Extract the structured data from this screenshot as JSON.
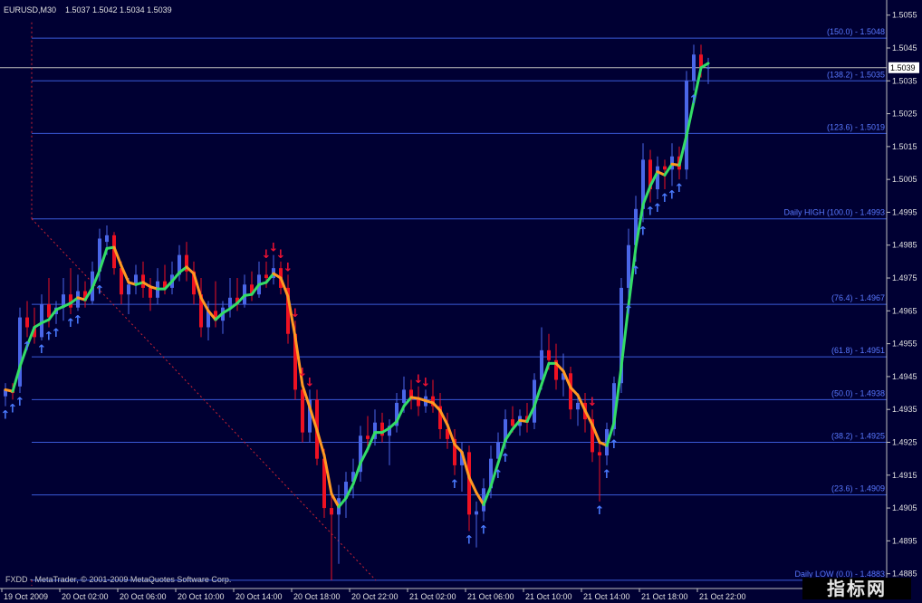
{
  "header": {
    "symbol_timeframe": "EURUSD,M30",
    "ohlc": "1.5037 1.5042 1.5034 1.5039"
  },
  "footer": {
    "copyright": "FXDD - MetaTrader, © 2001-2009 MetaQuotes Software Corp."
  },
  "watermark": "指标网",
  "colors": {
    "background": "#000033",
    "fib_line": "#3a5ad8",
    "fib_label": "#5878ff",
    "bull": "#4a66e8",
    "bear": "#ee1122",
    "ma_up": "#33dd66",
    "ma_down": "#ff9922",
    "arrow_up": "#4a7aff",
    "arrow_down": "#ee1133",
    "axis": "#c0c0c0",
    "price_line": "#c0c0c0"
  },
  "chart_data": {
    "type": "candlestick",
    "symbol": "EURUSD",
    "timeframe": "M30",
    "ylim": [
      1.48805,
      1.50585
    ],
    "price_ticks": [
      "1.5055",
      "1.5045",
      "1.5035",
      "1.5025",
      "1.5015",
      "1.5005",
      "1.4995",
      "1.4985",
      "1.4975",
      "1.4965",
      "1.4955",
      "1.4945",
      "1.4935",
      "1.4925",
      "1.4915",
      "1.4905",
      "1.4895",
      "1.4885"
    ],
    "time_labels": [
      {
        "label": "19 Oct 2009",
        "bar": 0
      },
      {
        "label": "20 Oct 02:00",
        "bar": 8
      },
      {
        "label": "20 Oct 06:00",
        "bar": 16
      },
      {
        "label": "20 Oct 10:00",
        "bar": 24
      },
      {
        "label": "20 Oct 14:00",
        "bar": 32
      },
      {
        "label": "20 Oct 18:00",
        "bar": 40
      },
      {
        "label": "20 Oct 22:00",
        "bar": 48
      },
      {
        "label": "21 Oct 02:00",
        "bar": 56
      },
      {
        "label": "21 Oct 06:00",
        "bar": 64
      },
      {
        "label": "21 Oct 10:00",
        "bar": 72
      },
      {
        "label": "21 Oct 14:00",
        "bar": 80
      },
      {
        "label": "21 Oct 18:00",
        "bar": 88
      },
      {
        "label": "21 Oct 22:00",
        "bar": 96
      }
    ],
    "current_price": "1.5039",
    "fib_levels": [
      {
        "label": "(150.0) - 1.5048",
        "price": 1.5048
      },
      {
        "label": "(138.2) - 1.5035",
        "price": 1.5035
      },
      {
        "label": "(123.6) - 1.5019",
        "price": 1.5019
      },
      {
        "label": "Daily HIGH (100.0) - 1.4993",
        "price": 1.4993
      },
      {
        "label": "(76.4) - 1.4967",
        "price": 1.4967
      },
      {
        "label": "(61.8) - 1.4951",
        "price": 1.4951
      },
      {
        "label": "(50.0) - 1.4938",
        "price": 1.4938
      },
      {
        "label": "(38.2) - 1.4925",
        "price": 1.4925
      },
      {
        "label": "(23.6) - 1.4909",
        "price": 1.4909
      },
      {
        "label": "Daily LOW (0.0) - 1.4883",
        "price": 1.4883
      }
    ],
    "candles": [
      [
        1.4939,
        1.4943,
        1.4936,
        1.4941
      ],
      [
        1.4941,
        1.4943,
        1.4938,
        1.494
      ],
      [
        1.4942,
        1.4966,
        1.494,
        1.4963
      ],
      [
        1.4963,
        1.4968,
        1.4957,
        1.496
      ],
      [
        1.496,
        1.4966,
        1.4955,
        1.4957
      ],
      [
        1.4957,
        1.497,
        1.4956,
        1.4967
      ],
      [
        1.4967,
        1.4975,
        1.496,
        1.4963
      ],
      [
        1.4964,
        1.4968,
        1.4961,
        1.4966
      ],
      [
        1.4966,
        1.4975,
        1.4962,
        1.497
      ],
      [
        1.497,
        1.4978,
        1.4964,
        1.4966
      ],
      [
        1.4966,
        1.4976,
        1.4965,
        1.4971
      ],
      [
        1.4971,
        1.4974,
        1.4966,
        1.4968
      ],
      [
        1.4968,
        1.498,
        1.4967,
        1.4977
      ],
      [
        1.4977,
        1.499,
        1.4974,
        1.4987
      ],
      [
        1.4986,
        1.4991,
        1.4982,
        1.4988
      ],
      [
        1.4988,
        1.4989,
        1.4976,
        1.4978
      ],
      [
        1.4978,
        1.498,
        1.4967,
        1.497
      ],
      [
        1.497,
        1.4975,
        1.4964,
        1.4973
      ],
      [
        1.4973,
        1.4979,
        1.497,
        1.4976
      ],
      [
        1.4976,
        1.498,
        1.4969,
        1.4972
      ],
      [
        1.4972,
        1.4975,
        1.4965,
        1.4969
      ],
      [
        1.4969,
        1.4978,
        1.4967,
        1.4974
      ],
      [
        1.4974,
        1.4979,
        1.497,
        1.4972
      ],
      [
        1.4972,
        1.498,
        1.497,
        1.4976
      ],
      [
        1.4976,
        1.4985,
        1.4974,
        1.4982
      ],
      [
        1.4982,
        1.4986,
        1.4974,
        1.4977
      ],
      [
        1.4977,
        1.498,
        1.4967,
        1.497
      ],
      [
        1.497,
        1.4975,
        1.4957,
        1.496
      ],
      [
        1.496,
        1.4968,
        1.4956,
        1.4965
      ],
      [
        1.4965,
        1.4974,
        1.496,
        1.4962
      ],
      [
        1.4962,
        1.4968,
        1.4958,
        1.4966
      ],
      [
        1.4966,
        1.4975,
        1.4963,
        1.4969
      ],
      [
        1.4969,
        1.4975,
        1.4965,
        1.4967
      ],
      [
        1.4967,
        1.4976,
        1.4966,
        1.4973
      ],
      [
        1.4973,
        1.4977,
        1.4968,
        1.497
      ],
      [
        1.497,
        1.498,
        1.4969,
        1.4976
      ],
      [
        1.4976,
        1.498,
        1.4972,
        1.4975
      ],
      [
        1.4975,
        1.4982,
        1.4973,
        1.4978
      ],
      [
        1.4978,
        1.498,
        1.497,
        1.4972
      ],
      [
        1.4972,
        1.4976,
        1.4955,
        1.4958
      ],
      [
        1.4958,
        1.4962,
        1.4938,
        1.4941
      ],
      [
        1.4941,
        1.4944,
        1.4925,
        1.4928
      ],
      [
        1.4928,
        1.4941,
        1.4925,
        1.4938
      ],
      [
        1.4938,
        1.4941,
        1.4918,
        1.492
      ],
      [
        1.492,
        1.4923,
        1.4902,
        1.4905
      ],
      [
        1.4905,
        1.4909,
        1.4883,
        1.4903
      ],
      [
        1.4903,
        1.4912,
        1.4888,
        1.4908
      ],
      [
        1.4908,
        1.4916,
        1.4902,
        1.4913
      ],
      [
        1.4913,
        1.492,
        1.4908,
        1.4916
      ],
      [
        1.4916,
        1.493,
        1.4913,
        1.4927
      ],
      [
        1.4927,
        1.4933,
        1.4922,
        1.4926
      ],
      [
        1.4926,
        1.4935,
        1.4924,
        1.4931
      ],
      [
        1.4931,
        1.4934,
        1.4925,
        1.4927
      ],
      [
        1.4927,
        1.4932,
        1.4918,
        1.493
      ],
      [
        1.493,
        1.494,
        1.4928,
        1.4937
      ],
      [
        1.4937,
        1.4945,
        1.4934,
        1.4941
      ],
      [
        1.4941,
        1.4944,
        1.4935,
        1.4938
      ],
      [
        1.4938,
        1.4942,
        1.4933,
        1.4936
      ],
      [
        1.4936,
        1.4941,
        1.4934,
        1.4939
      ],
      [
        1.4939,
        1.4944,
        1.4934,
        1.4936
      ],
      [
        1.4936,
        1.494,
        1.4926,
        1.4929
      ],
      [
        1.4929,
        1.4934,
        1.4923,
        1.4926
      ],
      [
        1.4926,
        1.4929,
        1.4915,
        1.4918
      ],
      [
        1.4918,
        1.4925,
        1.491,
        1.4922
      ],
      [
        1.4922,
        1.4924,
        1.4898,
        1.4903
      ],
      [
        1.4903,
        1.4907,
        1.4893,
        1.4904
      ],
      [
        1.4904,
        1.4914,
        1.4901,
        1.4911
      ],
      [
        1.4911,
        1.4924,
        1.4908,
        1.492
      ],
      [
        1.492,
        1.4928,
        1.4918,
        1.4925
      ],
      [
        1.4925,
        1.4935,
        1.4923,
        1.4932
      ],
      [
        1.4932,
        1.4936,
        1.4928,
        1.493
      ],
      [
        1.493,
        1.4935,
        1.4927,
        1.4933
      ],
      [
        1.4933,
        1.4937,
        1.4928,
        1.4931
      ],
      [
        1.4931,
        1.4946,
        1.4929,
        1.4944
      ],
      [
        1.4944,
        1.496,
        1.4941,
        1.4953
      ],
      [
        1.4953,
        1.4958,
        1.4947,
        1.495
      ],
      [
        1.495,
        1.4955,
        1.4941,
        1.4944
      ],
      [
        1.4944,
        1.4952,
        1.4939,
        1.4946
      ],
      [
        1.4946,
        1.4948,
        1.4932,
        1.4935
      ],
      [
        1.4935,
        1.494,
        1.493,
        1.4937
      ],
      [
        1.4937,
        1.494,
        1.4928,
        1.4932
      ],
      [
        1.4932,
        1.4935,
        1.4919,
        1.4922
      ],
      [
        1.4922,
        1.4926,
        1.4907,
        1.4921
      ],
      [
        1.4921,
        1.4931,
        1.4918,
        1.4929
      ],
      [
        1.4929,
        1.4945,
        1.4927,
        1.4943
      ],
      [
        1.4943,
        1.4975,
        1.494,
        1.4972
      ],
      [
        1.4972,
        1.499,
        1.4968,
        1.4985
      ],
      [
        1.4985,
        1.5,
        1.498,
        1.4996
      ],
      [
        1.4996,
        1.5016,
        1.4992,
        1.5011
      ],
      [
        1.5011,
        1.5014,
        1.4998,
        1.5002
      ],
      [
        1.5002,
        1.5012,
        1.4999,
        1.5009
      ],
      [
        1.5009,
        1.5011,
        1.5002,
        1.5008
      ],
      [
        1.5008,
        1.5016,
        1.5003,
        1.5012
      ],
      [
        1.5012,
        1.5015,
        1.5005,
        1.5008
      ],
      [
        1.5008,
        1.5038,
        1.5005,
        1.5035
      ],
      [
        1.5035,
        1.5046,
        1.5032,
        1.5043
      ],
      [
        1.5043,
        1.5046,
        1.5036,
        1.5039
      ],
      [
        1.5039,
        1.5042,
        1.5034,
        1.5039
      ]
    ],
    "arrows_up": [
      0,
      1,
      2,
      3,
      5,
      6,
      7,
      9,
      10,
      13,
      62,
      64,
      66,
      68,
      69,
      82,
      83,
      84,
      86,
      87,
      88,
      89,
      90,
      91,
      92,
      93,
      95
    ],
    "arrows_down": [
      36,
      37,
      38,
      39,
      40,
      41,
      42,
      57,
      58,
      81
    ]
  }
}
